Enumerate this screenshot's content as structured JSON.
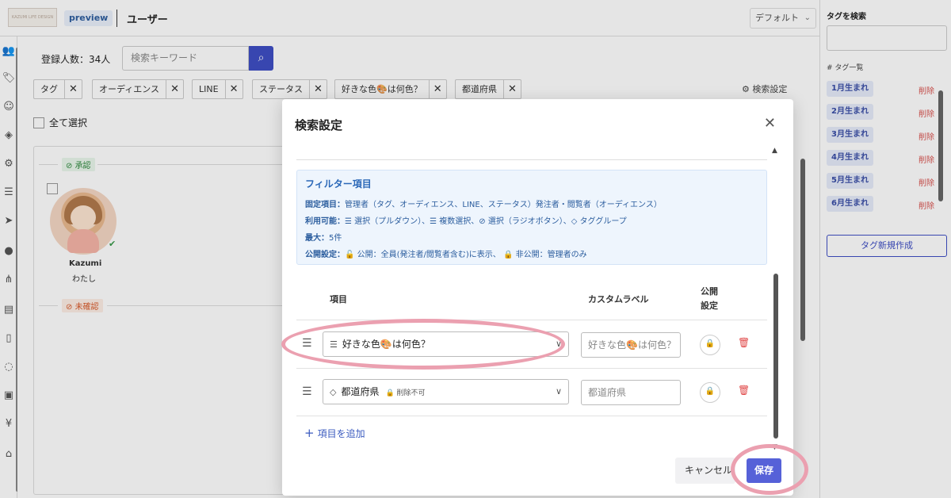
{
  "header": {
    "logo_text": "KAZUMI LIFE DESIGN",
    "preview_label": "preview",
    "page_title": "ユーザー",
    "view_select": "デフォルト"
  },
  "main": {
    "count_label": "登録人数：34人",
    "search_placeholder": "検索キーワード",
    "filters": [
      "タグ",
      "オーディエンス",
      "LINE",
      "ステータス",
      "好きな色🎨は何色？",
      "都道府県"
    ],
    "search_settings_label": "検索設定",
    "select_all_label": "全て選択",
    "status_approved": "承認",
    "status_unconfirmed": "未確認",
    "user": {
      "name": "Kazumi",
      "sub": "わたし"
    }
  },
  "side_panel": {
    "search_title": "タグを検索",
    "tag_list_title": "# タグ一覧",
    "tags": [
      "1月生まれ",
      "2月生まれ",
      "3月生まれ",
      "4月生まれ",
      "5月生まれ",
      "6月生まれ"
    ],
    "delete_label": "削除",
    "new_tag_label": "タグ新規作成"
  },
  "modal": {
    "title": "検索設定",
    "info": {
      "title": "フィルター項目",
      "fixed_key": "固定項目：",
      "fixed_val": "管理者（タグ、オーディエンス、LINE、ステータス）発注者・閲覧者（オーディエンス）",
      "usable_key": "利用可能：",
      "usable_val": "☰ 選択（プルダウン）、☰ 複数選択、⊘ 選択（ラジオボタン）、◇ タググループ",
      "max_key": "最大：",
      "max_val": "5件",
      "public_key": "公開設定：",
      "public_val": "🔓 公開：全員(発注者/閲覧者含む)に表示、 🔒 非公開：管理者のみ"
    },
    "table": {
      "col_item": "項目",
      "col_label": "カスタムラベル",
      "col_public_line1": "公開",
      "col_public_line2": "設定",
      "rows": [
        {
          "item": "好きな色🎨は何色？",
          "note": "",
          "label_value": "好きな色🎨は何色？"
        },
        {
          "item": "都道府県",
          "note": "🔒 削除不可",
          "label_value": "都道府県"
        }
      ]
    },
    "add_item_label": "項目を追加",
    "cancel_label": "キャンセル",
    "save_label": "保存"
  }
}
